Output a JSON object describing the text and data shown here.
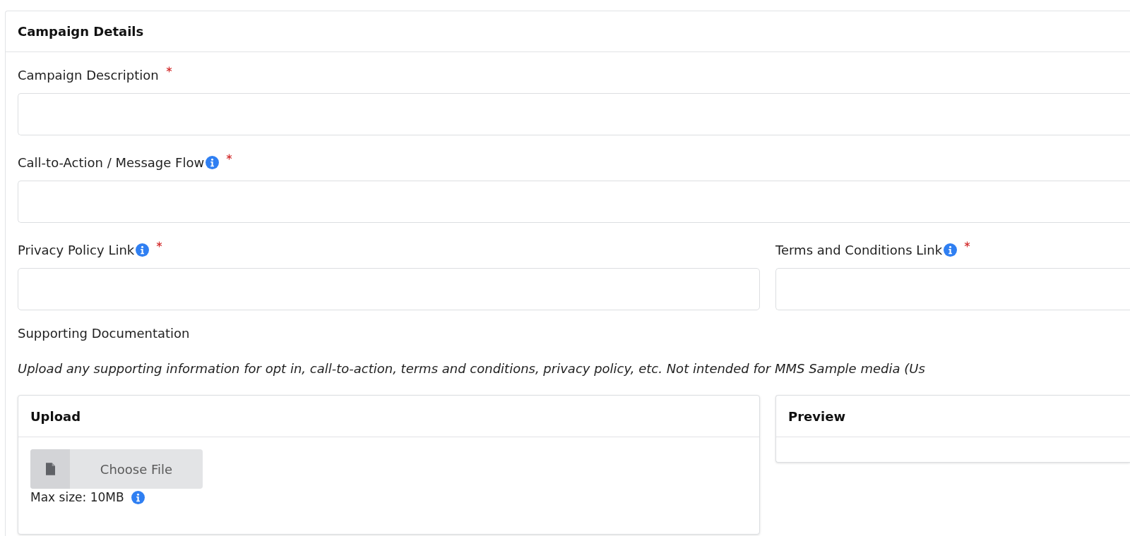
{
  "card": {
    "title": "Campaign Details"
  },
  "fields": [
    {
      "label": "Campaign Description",
      "required": true,
      "info": false,
      "kind": "full"
    },
    {
      "label": "Call-to-Action / Message Flow",
      "required": true,
      "info": true,
      "kind": "full"
    },
    {
      "label": "Privacy Policy Link",
      "required": true,
      "info": true,
      "kind": "half"
    },
    {
      "label": "Terms and Conditions Link",
      "required": true,
      "info": true,
      "kind": "half"
    }
  ],
  "supporting": {
    "label": "Supporting Documentation",
    "note": "Upload any supporting information for opt in, call-to-action, terms and conditions, privacy policy, etc. Not intended for MMS Sample media (Us",
    "upload": {
      "title": "Upload",
      "button": "Choose File",
      "max_size": "Max size: 10MB",
      "info": true
    },
    "preview": {
      "title": "Preview"
    }
  }
}
